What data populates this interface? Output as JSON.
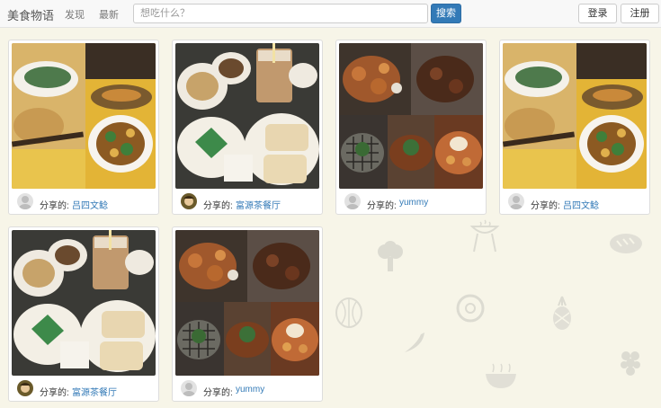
{
  "navbar": {
    "brand": "美食物语",
    "links": [
      "发现",
      "最新"
    ],
    "search_placeholder": "想吃什么？",
    "search_button": "搜索",
    "login": "登录",
    "register": "注册"
  },
  "background_icons": [
    "grill-icon",
    "bread-icon",
    "broccoli-icon",
    "watermelon-icon",
    "donut-icon",
    "pineapple-icon",
    "chili-icon",
    "grapes-icon",
    "bowl-icon"
  ],
  "share_label": "分享的:",
  "cards": [
    {
      "photo": "dumpling-dish-photo",
      "avatar": "default",
      "user": "吕四文鲶"
    },
    {
      "photo": "milk-tea-toast-photo",
      "avatar": "photo",
      "user": "富源茶餐厅"
    },
    {
      "photo": "grilled-meat-photo",
      "avatar": "default",
      "user": "yummy"
    },
    {
      "photo": "dumpling-dish-photo",
      "avatar": "default",
      "user": "吕四文鲶"
    },
    {
      "photo": "milk-tea-toast-photo",
      "avatar": "photo",
      "user": "富源茶餐厅"
    },
    {
      "photo": "grilled-meat-photo",
      "avatar": "default",
      "user": "yummy"
    }
  ],
  "colors": {
    "accent": "#337ab7",
    "page_background": "#f7f5e8",
    "navbar_background": "#f8f8f8"
  }
}
